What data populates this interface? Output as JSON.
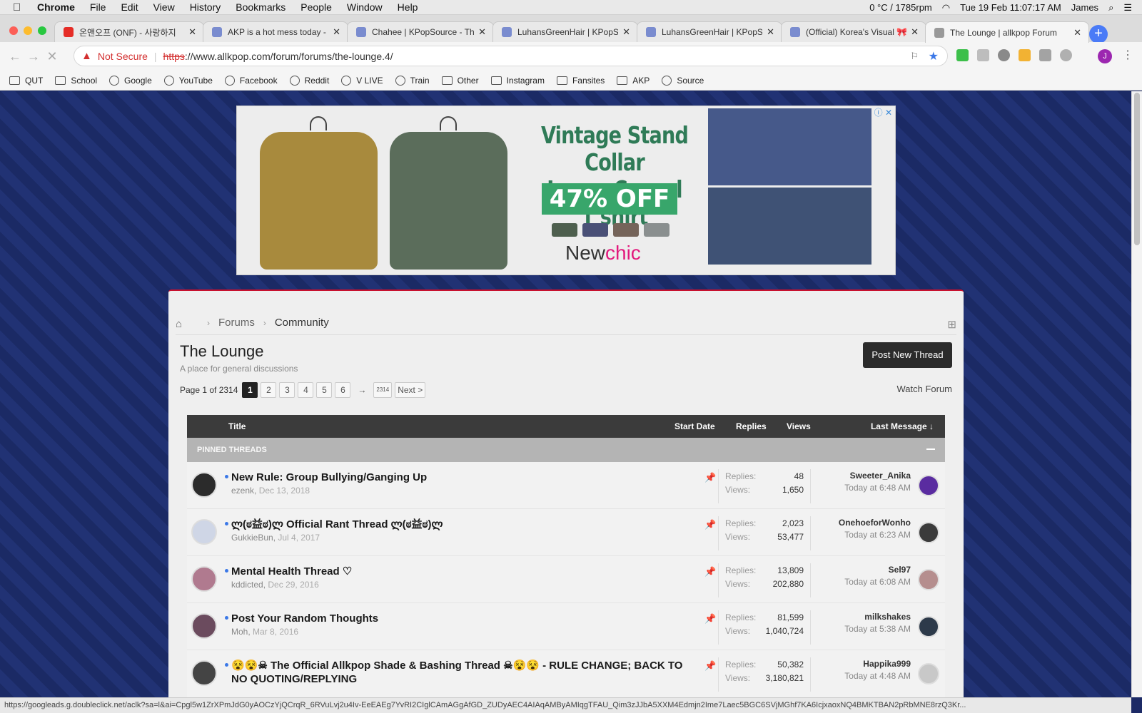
{
  "menubar": {
    "app": "Chrome",
    "items": [
      "File",
      "Edit",
      "View",
      "History",
      "Bookmarks",
      "People",
      "Window",
      "Help"
    ],
    "status": {
      "temp": "0 °C / 1785rpm",
      "datetime": "Tue 19 Feb  11:07:17 AM",
      "user": "James"
    }
  },
  "tabs": [
    {
      "label": "온앤오프 (ONF) - 사랑하지",
      "icon": "youtube-icon",
      "color": "#e52d27"
    },
    {
      "label": "AKP is a hot mess today - K",
      "icon": "allkpop-icon",
      "color": "#7a8ccf"
    },
    {
      "label": "Chahee | KPopSource - Th",
      "icon": "allkpop-icon",
      "color": "#7a8ccf"
    },
    {
      "label": "LuhansGreenHair | KPopSo",
      "icon": "allkpop-icon",
      "color": "#7a8ccf"
    },
    {
      "label": "LuhansGreenHair | KPopSo",
      "icon": "allkpop-icon",
      "color": "#7a8ccf"
    },
    {
      "label": "(Official) Korea's Visual 🎀",
      "icon": "allkpop-icon",
      "color": "#7a8ccf"
    },
    {
      "label": "The Lounge | allkpop Forum",
      "icon": "loading-icon",
      "color": "#999999"
    }
  ],
  "address": {
    "warning": "Not Secure",
    "protocol": "https",
    "rest": "://www.allkpop.com/forum/forums/the-lounge.4/"
  },
  "bookmarks": [
    {
      "label": "QUT",
      "icon": "folder-icon"
    },
    {
      "label": "School",
      "icon": "folder-icon"
    },
    {
      "label": "Google",
      "icon": "google-icon"
    },
    {
      "label": "YouTube",
      "icon": "youtube-icon"
    },
    {
      "label": "Facebook",
      "icon": "facebook-icon"
    },
    {
      "label": "Reddit",
      "icon": "reddit-icon"
    },
    {
      "label": "V LIVE",
      "icon": "vlive-icon"
    },
    {
      "label": "Train",
      "icon": "train-icon"
    },
    {
      "label": "Other",
      "icon": "folder-icon"
    },
    {
      "label": "Instagram",
      "icon": "folder-icon"
    },
    {
      "label": "Fansites",
      "icon": "folder-icon"
    },
    {
      "label": "AKP",
      "icon": "folder-icon"
    },
    {
      "label": "Source",
      "icon": "source-icon"
    }
  ],
  "ad": {
    "title_line1": "Vintage Stand Collar",
    "title_line2": "Loose Casual T shirt",
    "discount": "47% OFF",
    "brand_a": "New",
    "brand_b": "chic",
    "swatches": [
      "#4e5f4e",
      "#4a5077",
      "#75645a",
      "#8a8f8f"
    ]
  },
  "forum": {
    "breadcrumb": [
      "Forums",
      "Community"
    ],
    "title": "The Lounge",
    "subtitle": "A place for general discussions",
    "post_button": "Post New Thread",
    "watch": "Watch Forum",
    "pager": {
      "label": "Page 1 of 2314",
      "pages": [
        "1",
        "2",
        "3",
        "4",
        "5",
        "6"
      ],
      "last": "2314",
      "next": "Next >"
    },
    "columns": {
      "title": "Title",
      "start": "Start Date",
      "replies": "Replies",
      "views": "Views",
      "last": "Last Message ↓"
    },
    "pinned_label": "PINNED THREADS",
    "threads": [
      {
        "title": "New Rule: Group Bullying/Ganging Up",
        "author": "ezenk",
        "date": "Dec 13, 2018",
        "replies": "48",
        "views": "1,650",
        "last_user": "Sweeter_Anika",
        "last_time": "Today at 6:48 AM"
      },
      {
        "title": "ლ(ಠ益ಠ)ლ Official Rant Thread ლ(ಠ益ಠ)ლ",
        "author": "GukkieBun",
        "date": "Jul 4, 2017",
        "replies": "2,023",
        "views": "53,477",
        "last_user": "OnehoeforWonho",
        "last_time": "Today at 6:23 AM"
      },
      {
        "title": "Mental Health Thread ♡",
        "author": "kddicted",
        "date": "Dec 29, 2016",
        "replies": "13,809",
        "views": "202,880",
        "last_user": "Sel97",
        "last_time": "Today at 6:08 AM"
      },
      {
        "title": "Post Your Random Thoughts",
        "author": "Moh",
        "date": "Mar 8, 2016",
        "replies": "81,599",
        "views": "1,040,724",
        "last_user": "milkshakes",
        "last_time": "Today at 5:38 AM"
      },
      {
        "title": "😵😵☠ The Official Allkpop Shade & Bashing Thread ☠😵😵 - RULE CHANGE; BACK TO NO QUOTING/REPLYING",
        "author": "",
        "date": "",
        "replies": "50,382",
        "views": "3,180,821",
        "last_user": "Happika999",
        "last_time": "Today at 4:48 AM"
      }
    ],
    "replies_label": "Replies:",
    "views_label": "Views:"
  },
  "statusbar": "https://googleads.g.doubleclick.net/aclk?sa=l&ai=Cpgl5w1ZrXPmJdG0yAOCzYjQCrqR_6RVuLvj2u4Iv-EeEAEg7YvRI2CIglCAmAGgAfGD_ZUDyAEC4AIAqAMByAMIqgTFAU_Qim3zJJbA5XXM4Edmjn2Ime7Laec5BGC6SVjMGhf7KA6IcjxaoxNQ4BMKTBAN2pRbMNE8rzQ3Kr..."
}
